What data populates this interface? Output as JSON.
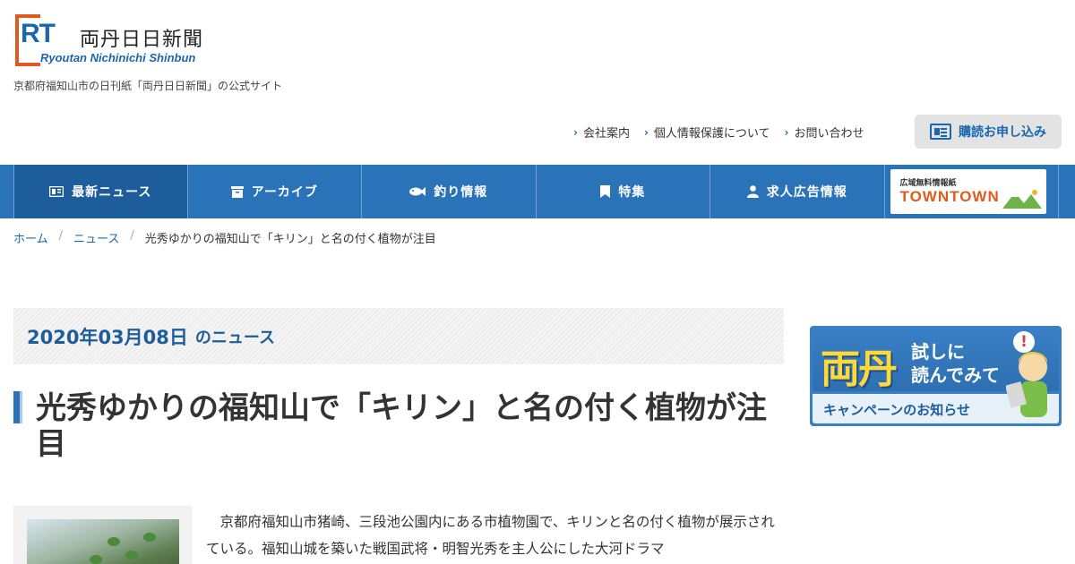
{
  "header": {
    "logo_mark": "RT",
    "logo_jp": "両丹日日新聞",
    "logo_en": "Ryoutan Nichinichi Shinbun",
    "tagline": "京都府福知山市の日刊紙「両丹日日新聞」の公式サイト",
    "links": [
      "会社案内",
      "個人情報保護について",
      "お問い合わせ"
    ],
    "subscribe_label": "購読お申し込み"
  },
  "nav": {
    "items": [
      {
        "label": "最新ニュース",
        "icon": "newspaper-icon"
      },
      {
        "label": "アーカイブ",
        "icon": "archive-box-icon"
      },
      {
        "label": "釣り情報",
        "icon": "fish-icon"
      },
      {
        "label": "特集",
        "icon": "bookmark-icon"
      },
      {
        "label": "求人広告情報",
        "icon": "person-icon"
      }
    ],
    "banner_small": "広域無料情報紙",
    "banner_big": "TOWNTOWN"
  },
  "breadcrumb": [
    "ホーム",
    "ニュース",
    "光秀ゆかりの福知山で「キリン」と名の付く植物が注目"
  ],
  "article": {
    "date": "2020年03月08日",
    "date_suffix": "のニュース",
    "title": "光秀ゆかりの福知山で「キリン」と名の付く植物が注目",
    "body": "　京都府福知山市猪崎、三段池公園内にある市植物園で、キリンと名の付く植物が展示されている。福知山城を築いた戦国武将・明智光秀を主人公にした大河ドラマ"
  },
  "side_banner": {
    "brand": "両丹",
    "line1": "試しに",
    "line2": "読んでみて",
    "cta": "キャンペーンのお知らせ",
    "mark": "!"
  },
  "colors": {
    "primary": "#2b73b8",
    "primary_dark": "#1d5d9b",
    "logo_orange": "#e05a1c",
    "text": "#333333"
  }
}
